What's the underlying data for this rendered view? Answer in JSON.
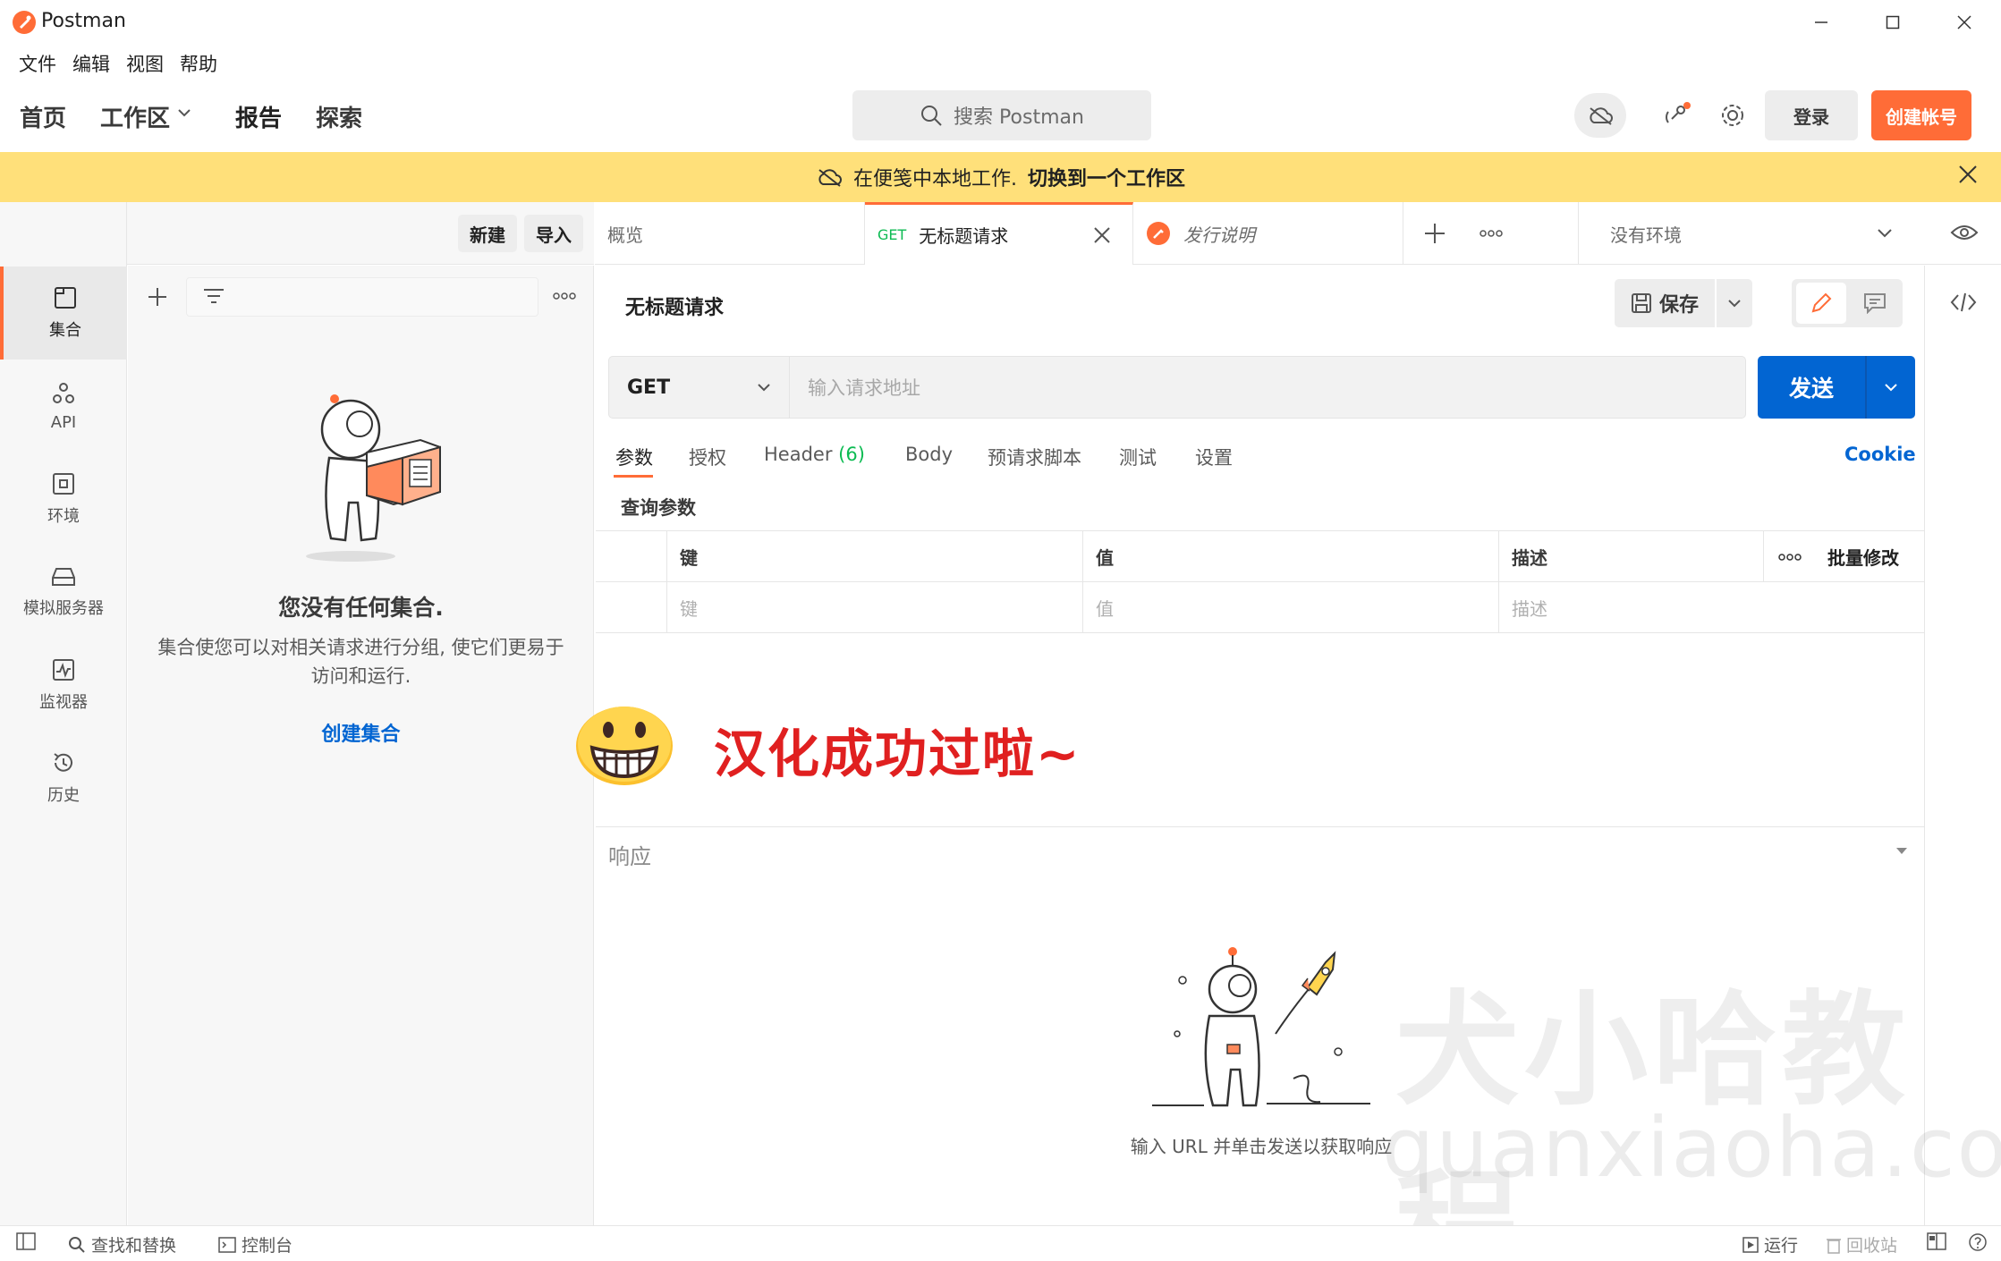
{
  "window": {
    "title": "Postman"
  },
  "menu": [
    "文件",
    "编辑",
    "视图",
    "帮助"
  ],
  "header": {
    "nav": {
      "home": "首页",
      "workspaces": "工作区",
      "reports": "报告",
      "explore": "探索"
    },
    "search_placeholder": "搜索 Postman",
    "signin": "登录",
    "signup": "创建帐号"
  },
  "banner": {
    "text": "在便笺中本地工作.",
    "link": "切换到一个工作区"
  },
  "workspace": {
    "name": "便笺",
    "new_btn": "新建",
    "import_btn": "导入"
  },
  "sidebar": {
    "items": [
      {
        "label": "集合",
        "icon": "collections-icon",
        "active": true
      },
      {
        "label": "API",
        "icon": "api-icon",
        "active": false
      },
      {
        "label": "环境",
        "icon": "environment-icon",
        "active": false
      },
      {
        "label": "模拟服务器",
        "icon": "mock-server-icon",
        "active": false
      },
      {
        "label": "监视器",
        "icon": "monitor-icon",
        "active": false
      },
      {
        "label": "历史",
        "icon": "history-icon",
        "active": false
      }
    ]
  },
  "collections": {
    "empty_title": "您没有任何集合.",
    "empty_desc": "集合使您可以对相关请求进行分组, 使它们更易于访问和运行.",
    "create_link": "创建集合"
  },
  "tabs": {
    "overview": "概览",
    "request_method": "GET",
    "request_name": "无标题请求",
    "release_notes": "发行说明",
    "environment": "没有环境"
  },
  "request": {
    "title": "无标题请求",
    "save": "保存",
    "method": "GET",
    "url_placeholder": "输入请求地址",
    "send": "发送",
    "tabs": {
      "params": "参数",
      "auth": "授权",
      "headers": "Header",
      "headers_count": "(6)",
      "body": "Body",
      "prerequest": "预请求脚本",
      "tests": "测试",
      "settings": "设置"
    },
    "cookie": "Cookie",
    "query_title": "查询参数",
    "table": {
      "headers": {
        "key": "键",
        "value": "值",
        "description": "描述",
        "bulk_edit": "批量修改"
      },
      "placeholders": {
        "key": "键",
        "value": "值",
        "description": "描述"
      }
    }
  },
  "overlay": {
    "text": "汉化成功过啦~"
  },
  "response": {
    "title": "响应",
    "hint": "输入 URL 并单击发送以获取响应"
  },
  "watermark": {
    "cn": "犬小哈教程",
    "en": "quanxiaoha.com"
  },
  "statusbar": {
    "find_replace": "查找和替换",
    "console": "控制台",
    "runner": "运行",
    "trash": "回收站"
  },
  "colors": {
    "accent": "#ff6c37",
    "primary": "#0265d2",
    "banner": "#ffe07a",
    "overlay_text": "#e02020"
  }
}
